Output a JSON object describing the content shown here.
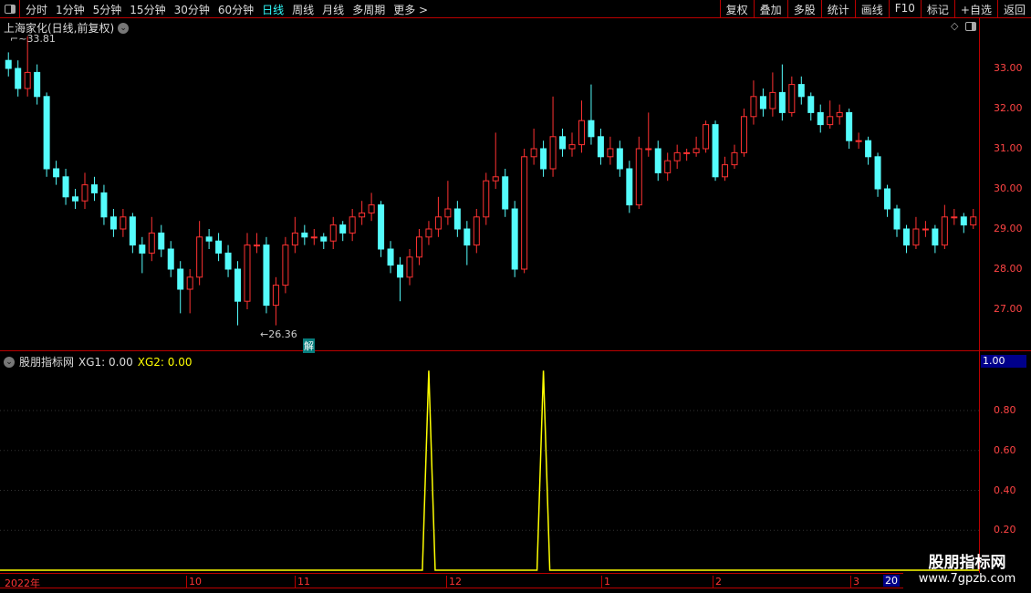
{
  "toolbar": {
    "periods": [
      "分时",
      "1分钟",
      "5分钟",
      "15分钟",
      "30分钟",
      "60分钟",
      "日线",
      "周线",
      "月线",
      "多周期",
      "更多 >"
    ],
    "active": "日线",
    "tools": [
      "复权",
      "叠加",
      "多股",
      "统计",
      "画线",
      "F10",
      "标记",
      "+自选",
      "返回"
    ]
  },
  "main": {
    "title": "上海家化(日线,前复权)",
    "high_label": "33.81",
    "low_label": "26.36",
    "badge": "解",
    "price_ticks": [
      "33.00",
      "32.00",
      "31.00",
      "30.00",
      "29.00",
      "28.00",
      "27.00"
    ]
  },
  "indicator": {
    "name": "股朋指标网",
    "xg1": "XG1: 0.00",
    "xg2": "XG2: 0.00",
    "current": "1.00",
    "ticks": [
      "0.80",
      "0.60",
      "0.40",
      "0.20"
    ]
  },
  "axis": {
    "labels": [
      "2022年",
      "10",
      "11",
      "12",
      "1",
      "2",
      "3"
    ],
    "current": "20"
  },
  "watermark": {
    "line1": "股朋指标网",
    "line2": "www.7gpzb.com"
  },
  "colors": {
    "up": "#ff3232",
    "down": "#54fcfc",
    "signal": "#ffff00",
    "frame": "#bb0000"
  },
  "chart_data": {
    "type": "candlestick",
    "price_range": [
      26.2,
      33.9
    ],
    "candles": [
      [
        33.2,
        33.4,
        32.8,
        33.0
      ],
      [
        33.0,
        33.2,
        32.3,
        32.5
      ],
      [
        32.5,
        33.8,
        32.3,
        32.9
      ],
      [
        32.9,
        33.1,
        32.1,
        32.3
      ],
      [
        32.3,
        32.4,
        30.3,
        30.5
      ],
      [
        30.5,
        30.7,
        30.1,
        30.3
      ],
      [
        30.3,
        30.5,
        29.6,
        29.8
      ],
      [
        29.8,
        30.0,
        29.5,
        29.7
      ],
      [
        29.7,
        30.4,
        29.5,
        30.1
      ],
      [
        30.1,
        30.3,
        29.7,
        29.9
      ],
      [
        29.9,
        30.1,
        29.1,
        29.3
      ],
      [
        29.3,
        29.5,
        28.8,
        29.0
      ],
      [
        29.0,
        29.5,
        28.8,
        29.3
      ],
      [
        29.3,
        29.4,
        28.4,
        28.6
      ],
      [
        28.6,
        28.8,
        27.9,
        28.4
      ],
      [
        28.4,
        29.3,
        28.2,
        28.9
      ],
      [
        28.9,
        29.1,
        28.3,
        28.5
      ],
      [
        28.5,
        28.7,
        27.8,
        28.0
      ],
      [
        28.0,
        28.2,
        26.9,
        27.5
      ],
      [
        27.5,
        28.0,
        26.9,
        27.8
      ],
      [
        27.8,
        29.2,
        27.6,
        28.8
      ],
      [
        28.8,
        29.0,
        28.5,
        28.7
      ],
      [
        28.7,
        28.9,
        28.2,
        28.4
      ],
      [
        28.4,
        28.6,
        27.8,
        28.0
      ],
      [
        28.0,
        28.2,
        26.6,
        27.2
      ],
      [
        27.2,
        28.9,
        27.0,
        28.6
      ],
      [
        28.6,
        28.9,
        28.4,
        28.6
      ],
      [
        28.6,
        28.8,
        26.9,
        27.1
      ],
      [
        27.1,
        27.8,
        26.6,
        27.6
      ],
      [
        27.6,
        28.8,
        27.4,
        28.6
      ],
      [
        28.6,
        29.3,
        28.4,
        28.9
      ],
      [
        28.9,
        29.1,
        28.6,
        28.8
      ],
      [
        28.8,
        29.0,
        28.6,
        28.8
      ],
      [
        28.8,
        28.9,
        28.5,
        28.7
      ],
      [
        28.7,
        29.3,
        28.5,
        29.1
      ],
      [
        29.1,
        29.2,
        28.7,
        28.9
      ],
      [
        28.9,
        29.5,
        28.7,
        29.3
      ],
      [
        29.3,
        29.7,
        29.1,
        29.4
      ],
      [
        29.4,
        29.9,
        29.2,
        29.6
      ],
      [
        29.6,
        29.7,
        28.3,
        28.5
      ],
      [
        28.5,
        28.7,
        27.9,
        28.1
      ],
      [
        28.1,
        28.3,
        27.2,
        27.8
      ],
      [
        27.8,
        28.5,
        27.6,
        28.3
      ],
      [
        28.3,
        29.0,
        28.1,
        28.8
      ],
      [
        28.8,
        29.2,
        28.6,
        29.0
      ],
      [
        29.0,
        29.8,
        28.8,
        29.3
      ],
      [
        29.3,
        30.2,
        29.1,
        29.5
      ],
      [
        29.5,
        29.7,
        28.8,
        29.0
      ],
      [
        29.0,
        29.2,
        28.1,
        28.6
      ],
      [
        28.6,
        29.5,
        28.4,
        29.3
      ],
      [
        29.3,
        30.4,
        29.1,
        30.2
      ],
      [
        30.2,
        31.4,
        30.0,
        30.3
      ],
      [
        30.3,
        30.5,
        29.3,
        29.5
      ],
      [
        29.5,
        29.7,
        27.8,
        28.0
      ],
      [
        28.0,
        31.0,
        27.9,
        30.8
      ],
      [
        30.8,
        31.5,
        30.6,
        31.0
      ],
      [
        31.0,
        31.2,
        30.3,
        30.5
      ],
      [
        30.5,
        32.3,
        30.3,
        31.3
      ],
      [
        31.3,
        31.5,
        30.8,
        31.0
      ],
      [
        31.0,
        31.4,
        30.8,
        31.1
      ],
      [
        31.1,
        32.2,
        30.9,
        31.7
      ],
      [
        31.7,
        32.6,
        31.1,
        31.3
      ],
      [
        31.3,
        31.5,
        30.6,
        30.8
      ],
      [
        30.8,
        31.3,
        30.6,
        31.0
      ],
      [
        31.0,
        31.2,
        30.3,
        30.5
      ],
      [
        30.5,
        30.7,
        29.4,
        29.6
      ],
      [
        29.6,
        31.3,
        29.5,
        31.0
      ],
      [
        31.0,
        31.9,
        30.8,
        31.0
      ],
      [
        31.0,
        31.2,
        30.2,
        30.4
      ],
      [
        30.4,
        30.9,
        30.2,
        30.7
      ],
      [
        30.7,
        31.1,
        30.5,
        30.9
      ],
      [
        30.9,
        31.0,
        30.7,
        30.9
      ],
      [
        30.9,
        31.3,
        30.8,
        31.0
      ],
      [
        31.0,
        31.7,
        30.9,
        31.6
      ],
      [
        31.6,
        31.7,
        30.2,
        30.3
      ],
      [
        30.3,
        30.8,
        30.2,
        30.6
      ],
      [
        30.6,
        31.1,
        30.5,
        30.9
      ],
      [
        30.9,
        32.0,
        30.8,
        31.8
      ],
      [
        31.8,
        32.7,
        31.6,
        32.3
      ],
      [
        32.3,
        32.5,
        31.8,
        32.0
      ],
      [
        32.0,
        32.9,
        31.8,
        32.4
      ],
      [
        32.4,
        33.1,
        31.7,
        31.9
      ],
      [
        31.9,
        32.8,
        31.8,
        32.6
      ],
      [
        32.6,
        32.8,
        32.1,
        32.3
      ],
      [
        32.3,
        32.4,
        31.7,
        31.9
      ],
      [
        31.9,
        32.1,
        31.4,
        31.6
      ],
      [
        31.6,
        32.2,
        31.5,
        31.8
      ],
      [
        31.8,
        32.1,
        31.6,
        31.9
      ],
      [
        31.9,
        32.0,
        31.0,
        31.2
      ],
      [
        31.2,
        31.4,
        31.0,
        31.2
      ],
      [
        31.2,
        31.3,
        30.6,
        30.8
      ],
      [
        30.8,
        30.9,
        29.8,
        30.0
      ],
      [
        30.0,
        30.1,
        29.3,
        29.5
      ],
      [
        29.5,
        29.6,
        28.8,
        29.0
      ],
      [
        29.0,
        29.1,
        28.4,
        28.6
      ],
      [
        28.6,
        29.3,
        28.5,
        29.0
      ],
      [
        29.0,
        29.2,
        28.8,
        29.0
      ],
      [
        29.0,
        29.1,
        28.4,
        28.6
      ],
      [
        28.6,
        29.6,
        28.5,
        29.3
      ],
      [
        29.3,
        29.5,
        29.1,
        29.3
      ],
      [
        29.3,
        29.4,
        28.9,
        29.1
      ],
      [
        29.1,
        29.5,
        29.0,
        29.3
      ]
    ],
    "signal_indices": [
      44,
      56
    ],
    "signal_value": 1.0,
    "indicator_range": [
      0,
      1.05
    ]
  }
}
